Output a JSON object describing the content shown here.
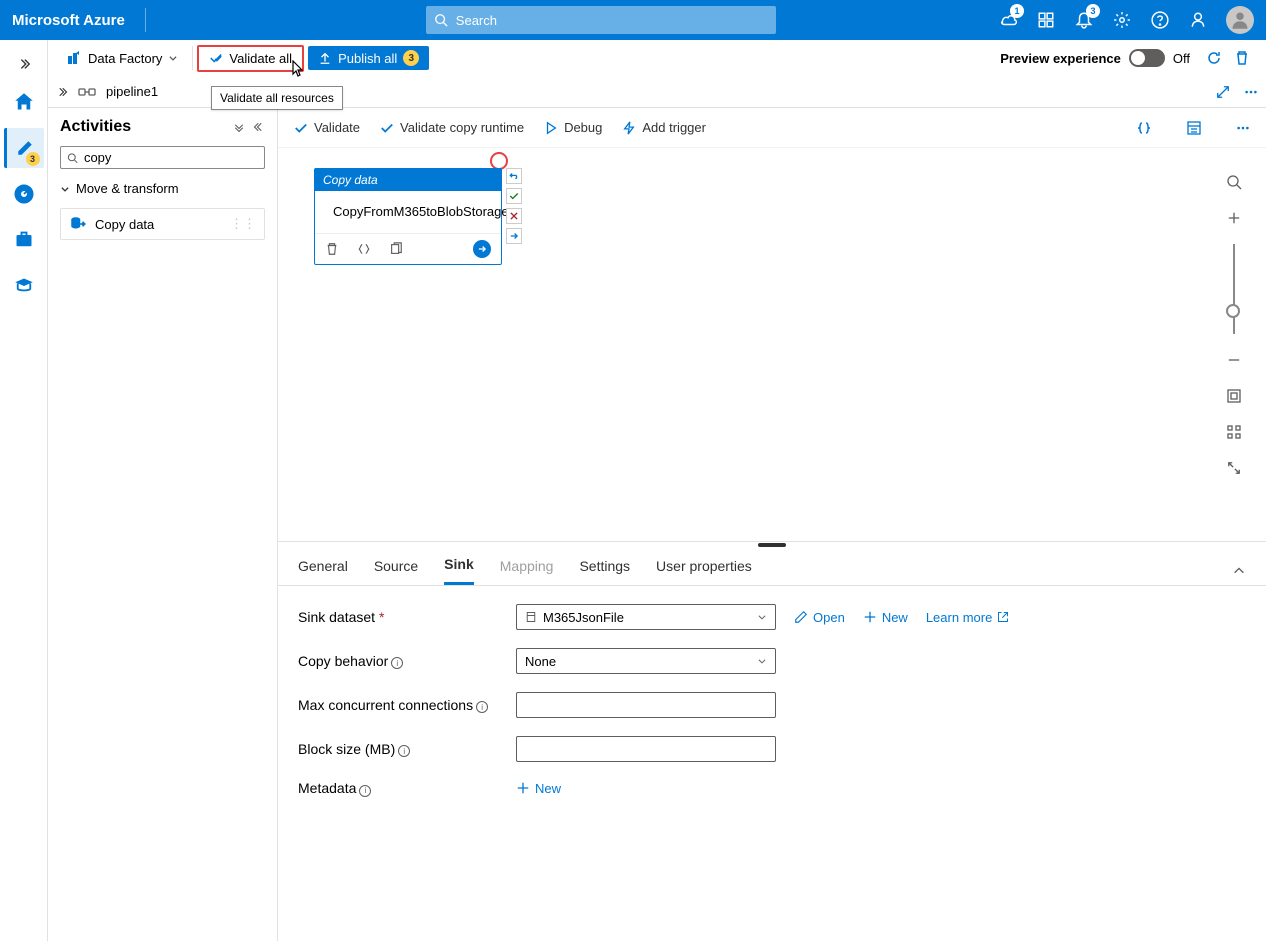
{
  "header": {
    "logo": "Microsoft Azure",
    "search_placeholder": "Search",
    "chat_badge": "1",
    "bell_badge": "3"
  },
  "far_left": {
    "pencil_badge": "3"
  },
  "toolbar": {
    "data_factory_label": "Data Factory",
    "validate_all_label": "Validate all",
    "publish_all_label": "Publish all",
    "publish_count": "3",
    "preview_label": "Preview experience",
    "toggle_off": "Off"
  },
  "tooltip": {
    "text": "Validate all resources"
  },
  "breadcrumb": {
    "pipeline_name": "pipeline1"
  },
  "activities": {
    "title": "Activities",
    "search_value": "copy",
    "category": "Move & transform",
    "items": [
      {
        "label": "Copy data"
      }
    ]
  },
  "canvas_toolbar": {
    "validate": "Validate",
    "validate_copy": "Validate copy runtime",
    "debug": "Debug",
    "add_trigger": "Add trigger"
  },
  "node": {
    "title": "Copy data",
    "name": "CopyFromM365toBlobStorage"
  },
  "tabs": {
    "general": "General",
    "source": "Source",
    "sink": "Sink",
    "mapping": "Mapping",
    "settings": "Settings",
    "user_props": "User properties"
  },
  "form": {
    "sink_dataset_label": "Sink dataset",
    "sink_dataset_value": "M365JsonFile",
    "open": "Open",
    "new": "New",
    "learn_more": "Learn more",
    "copy_behavior_label": "Copy behavior",
    "copy_behavior_value": "None",
    "max_conn_label": "Max concurrent connections",
    "block_size_label": "Block size (MB)",
    "metadata_label": "Metadata",
    "metadata_new": "New"
  }
}
